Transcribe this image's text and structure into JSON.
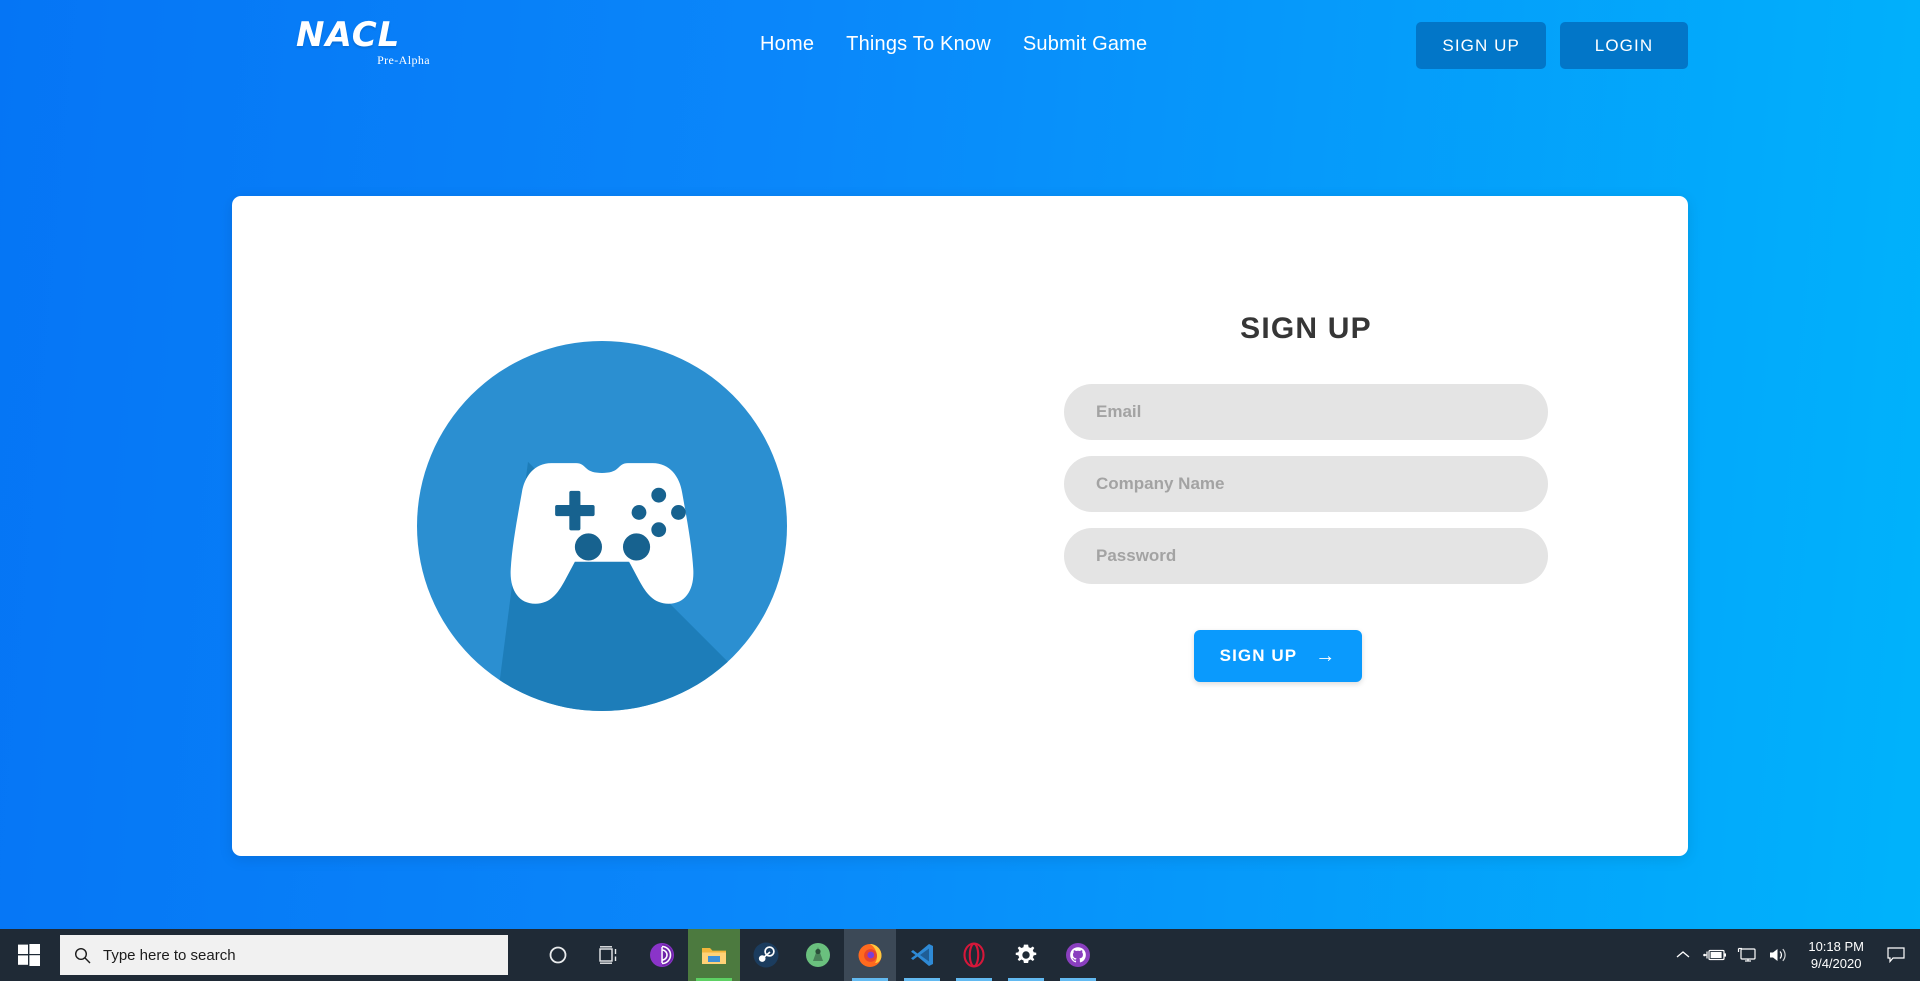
{
  "theme": {
    "bg_gradient_from": "#0575f5",
    "bg_gradient_to": "#00b3fb",
    "header_button_bg": "#0276c8",
    "accent_button_bg": "#0a9afd",
    "card_bg": "#ffffff",
    "input_bg": "#e4e4e4",
    "input_placeholder": "#a3a3a3",
    "heading_color": "#363636",
    "taskbar_bg": "#1f2a36"
  },
  "header": {
    "logo": {
      "word": "NACL",
      "subtitle": "Pre-Alpha"
    },
    "nav": [
      {
        "label": "Home",
        "name": "nav-home"
      },
      {
        "label": "Things To Know",
        "name": "nav-things-to-know"
      },
      {
        "label": "Submit Game",
        "name": "nav-submit-game"
      }
    ],
    "actions": [
      {
        "label": "SIGN UP",
        "name": "header-signup-button"
      },
      {
        "label": "LOGIN",
        "name": "header-login-button"
      }
    ]
  },
  "card": {
    "illustration": {
      "icon": "gamepad-icon",
      "circle_color": "#2b8fd1",
      "shadow_color": "#1b6fa8",
      "controller_color": "#ffffff",
      "button_color": "#17628f"
    },
    "form": {
      "title": "SIGN UP",
      "fields": [
        {
          "name": "email-input",
          "placeholder": "Email",
          "value": "",
          "type": "email"
        },
        {
          "name": "company-name-input",
          "placeholder": "Company Name",
          "value": "",
          "type": "text"
        },
        {
          "name": "password-input",
          "placeholder": "Password",
          "value": "",
          "type": "password"
        }
      ],
      "submit": {
        "label": "SIGN UP",
        "arrow": "→"
      }
    }
  },
  "taskbar": {
    "start": "windows-logo-icon",
    "search": {
      "placeholder": "Type here to search",
      "icon": "search-icon"
    },
    "icons": [
      {
        "name": "cortana-icon",
        "label": "Cortana",
        "underline": "none"
      },
      {
        "name": "task-view-icon",
        "label": "Task View",
        "underline": "none"
      },
      {
        "name": "tor-browser-icon",
        "label": "Tor Browser",
        "underline": "none"
      },
      {
        "name": "file-explorer-icon",
        "label": "File Explorer",
        "underline": "#5dd063"
      },
      {
        "name": "steam-icon",
        "label": "Steam",
        "underline": "none"
      },
      {
        "name": "android-studio-icon",
        "label": "Android Studio",
        "underline": "none"
      },
      {
        "name": "firefox-icon",
        "label": "Firefox",
        "underline": "#62b9f0"
      },
      {
        "name": "vs-code-icon",
        "label": "Visual Studio Code",
        "underline": "#62b9f0"
      },
      {
        "name": "opera-gx-icon",
        "label": "Opera GX",
        "underline": "#62b9f0"
      },
      {
        "name": "settings-gear-icon",
        "label": "Settings",
        "underline": "#62b9f0"
      },
      {
        "name": "github-desktop-icon",
        "label": "GitHub Desktop",
        "underline": "#62b9f0"
      }
    ],
    "tray": [
      {
        "name": "show-hidden-icons-chevron-icon",
        "label": "Show hidden icons"
      },
      {
        "name": "battery-charging-icon",
        "label": "Battery"
      },
      {
        "name": "display-icon",
        "label": "Display"
      },
      {
        "name": "volume-icon",
        "label": "Volume"
      }
    ],
    "clock": {
      "time": "10:18 PM",
      "date": "9/4/2020"
    },
    "action_center": {
      "name": "action-center-icon",
      "label": "Notifications"
    }
  }
}
